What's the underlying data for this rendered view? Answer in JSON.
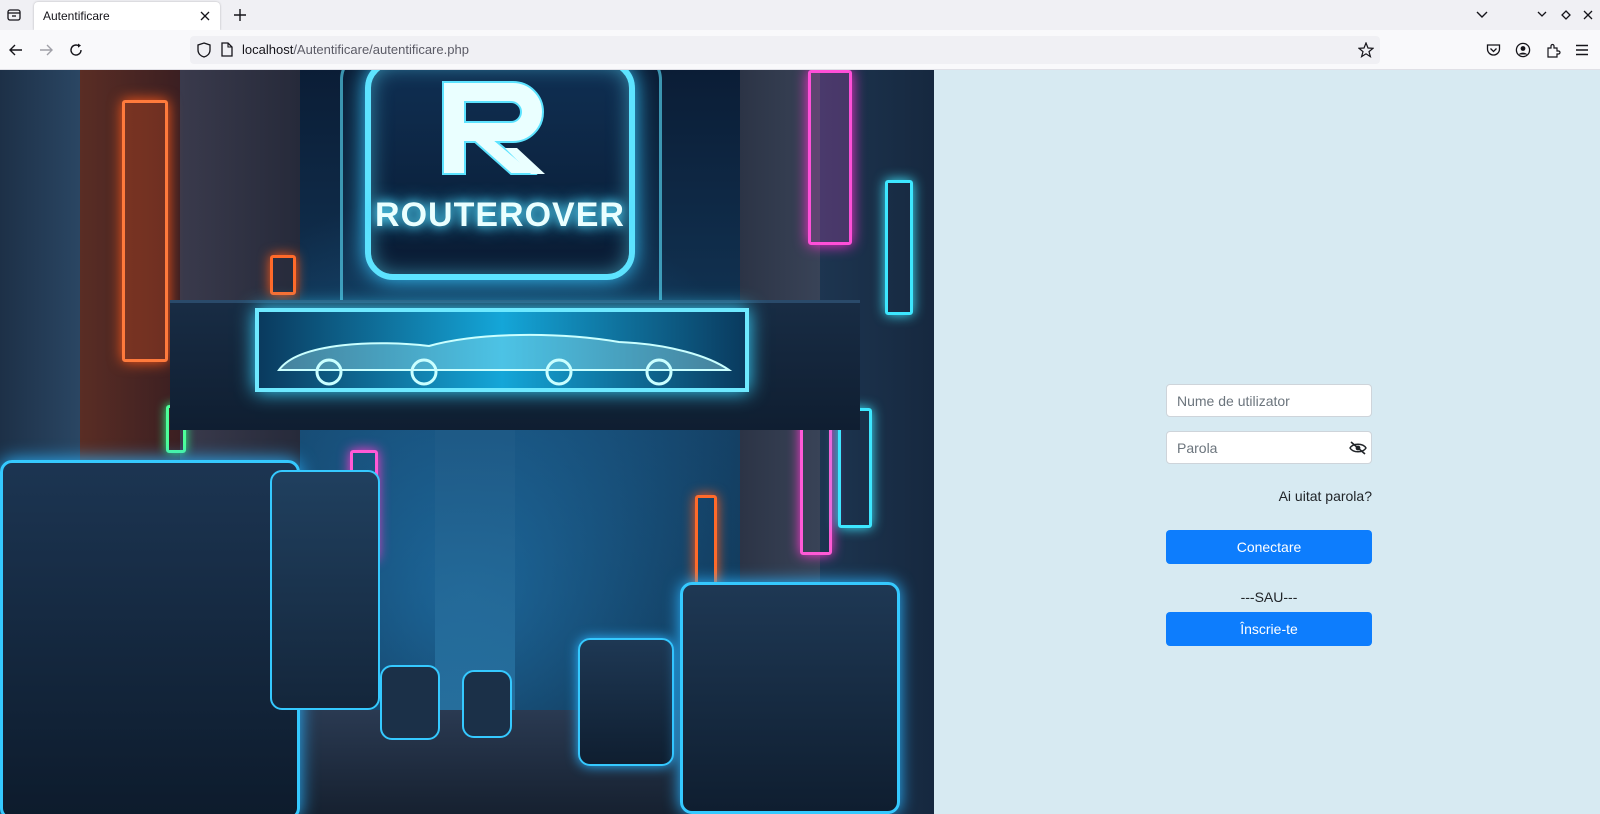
{
  "browser": {
    "tab_title": "Autentificare",
    "url_host": "localhost",
    "url_path": "/Autentificare/autentificare.php"
  },
  "icons": {
    "tab_list": "tab-list-icon",
    "close_tab": "close-icon",
    "new_tab": "plus-icon",
    "back": "arrow-left-icon",
    "forward": "arrow-right-icon",
    "reload": "reload-icon",
    "shield": "shield-icon",
    "page": "page-icon",
    "bookmark": "star-icon",
    "pocket": "pocket-icon",
    "account": "account-icon",
    "extensions": "puzzle-icon",
    "menu": "hamburger-icon",
    "password_toggle": "eye-slash-icon"
  },
  "hero": {
    "brand": "ROUTEROVER"
  },
  "login": {
    "username_placeholder": "Nume de utilizator",
    "password_placeholder": "Parola",
    "forgot_password": "Ai uitat parola?",
    "login_button": "Conectare",
    "separator": "---SAU---",
    "signup_button": "Înscrie-te"
  },
  "colors": {
    "panel_bg": "#d7eaf2",
    "button_primary": "#0d7dfd"
  }
}
